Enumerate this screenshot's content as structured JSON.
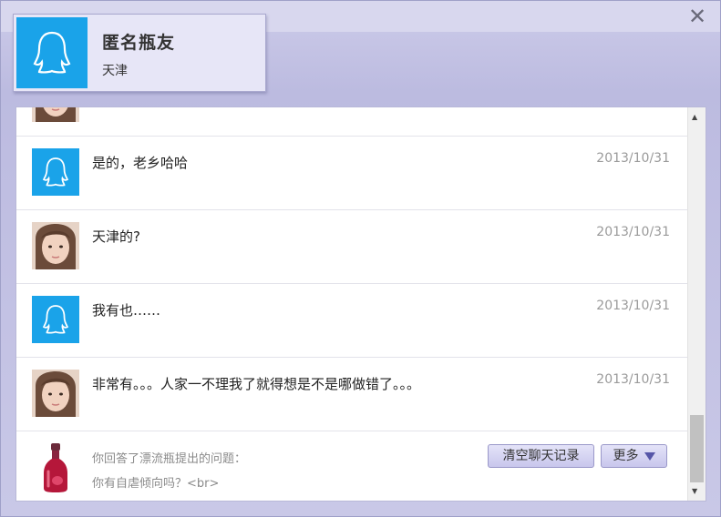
{
  "header": {
    "close_glyph": "✕"
  },
  "profile": {
    "name": "匿名瓶友",
    "city": "天津",
    "avatar": "qq-penguin-icon"
  },
  "messages": [
    {
      "text": "是的，老乡哈哈",
      "date": "2013/10/31",
      "avatar": "qq-penguin-icon"
    },
    {
      "text": "天津的?",
      "date": "2013/10/31",
      "avatar": "girl-photo"
    },
    {
      "text": "我有也……",
      "date": "2013/10/31",
      "avatar": "qq-penguin-icon"
    },
    {
      "text": "非常有。。。人家一不理我了就得想是不是哪做错了。。。",
      "date": "2013/10/31",
      "avatar": "girl-photo"
    }
  ],
  "footer": {
    "label": "你回答了漂流瓶提出的问题：",
    "question": "你有自虐倾向吗？<br>",
    "clear_button": "清空聊天记录",
    "more_button": "更多"
  },
  "colors": {
    "accent_blue": "#1aa3e9",
    "window_bg": "#c7c6e6",
    "bottle_red": "#b5173a"
  }
}
